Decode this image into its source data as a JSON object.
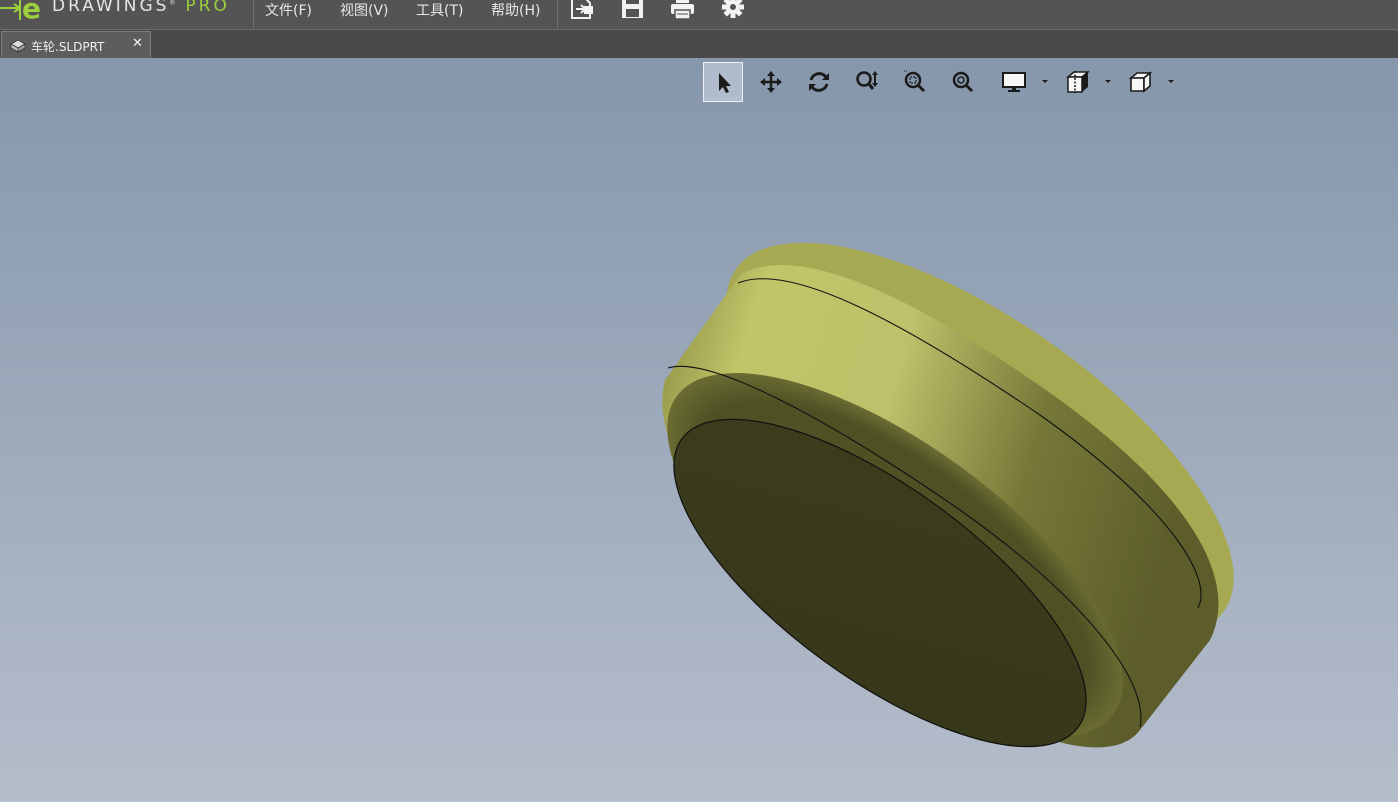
{
  "app": {
    "logo_brand": "DRAWINGS",
    "logo_edition": "PRO",
    "logo_tm": "®",
    "accent_color": "#9ccf3c"
  },
  "menu": {
    "items": [
      {
        "label": "文件(F)"
      },
      {
        "label": "视图(V)"
      },
      {
        "label": "工具(T)"
      },
      {
        "label": "帮助(H)"
      }
    ]
  },
  "quick_access": [
    {
      "icon": "open-icon"
    },
    {
      "icon": "save-icon"
    },
    {
      "icon": "print-icon"
    },
    {
      "icon": "gear-icon"
    }
  ],
  "tabs": [
    {
      "label": "车轮.SLDPRT",
      "close": "✕",
      "icon": "part-icon"
    }
  ],
  "view_toolbar": [
    {
      "icon": "select-arrow-icon",
      "active": true
    },
    {
      "icon": "pan-icon"
    },
    {
      "icon": "rotate-icon"
    },
    {
      "icon": "zoom-in-out-icon"
    },
    {
      "icon": "zoom-to-area-icon"
    },
    {
      "icon": "zoom-to-fit-icon"
    },
    {
      "icon": "display-style-icon",
      "dropdown": true
    },
    {
      "icon": "section-view-icon",
      "dropdown": true
    },
    {
      "icon": "standard-views-icon",
      "dropdown": true
    }
  ],
  "model": {
    "name": "wheel",
    "color": "#b8bb5c",
    "shadow_color": "#3b3b1d"
  }
}
